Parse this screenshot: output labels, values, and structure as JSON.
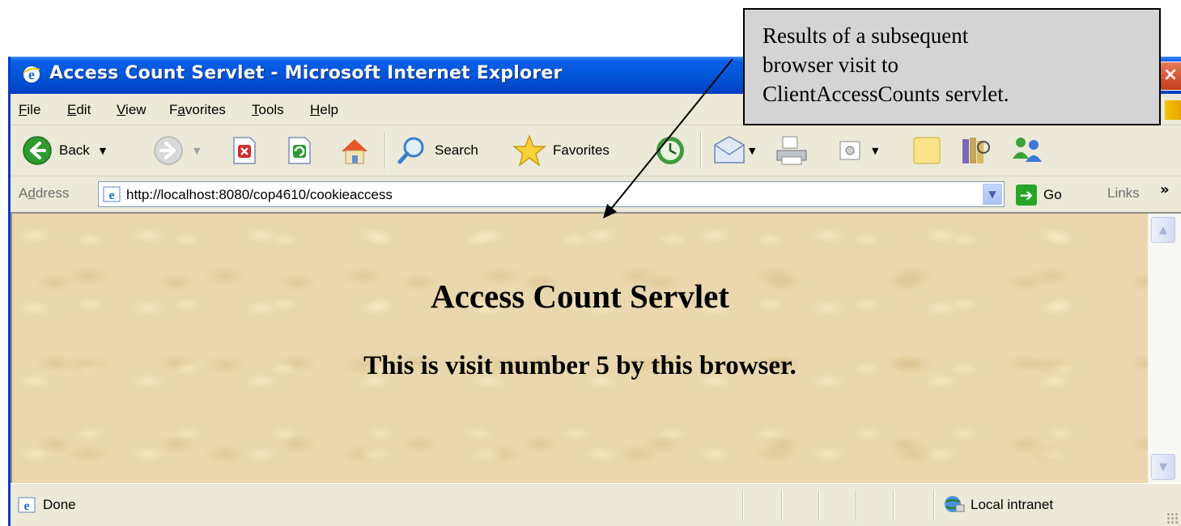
{
  "window": {
    "title": "Access Count Servlet - Microsoft Internet Explorer",
    "close_glyph": "×"
  },
  "menu": {
    "items": [
      {
        "accel": "F",
        "rest": "ile"
      },
      {
        "accel": "E",
        "rest": "dit"
      },
      {
        "accel": "V",
        "rest": "iew"
      },
      {
        "pre": "F",
        "accel": "a",
        "rest": "vorites"
      },
      {
        "accel": "T",
        "rest": "ools"
      },
      {
        "accel": "H",
        "rest": "elp"
      }
    ]
  },
  "toolbar": {
    "back_label": "Back",
    "search_label": "Search",
    "favorites_label": "Favorites",
    "dropdown_glyph": "▼"
  },
  "address": {
    "label_pre": "A",
    "label_accel": "d",
    "label_rest": "dress",
    "url": "http://localhost:8080/cop4610/cookieaccess",
    "go_label": "Go",
    "go_glyph": "➔",
    "links_label": "Links",
    "links_chevron": "»",
    "dropdown_glyph": "▼"
  },
  "page": {
    "heading": "Access Count Servlet",
    "subheading": "This is visit number 5 by this browser."
  },
  "scrollbar": {
    "up_glyph": "▲",
    "down_glyph": "▼"
  },
  "status": {
    "text": "Done",
    "zone": "Local intranet"
  },
  "callout": {
    "lines": [
      "Results of a subsequent",
      "browser visit to",
      "ClientAccessCounts servlet."
    ]
  },
  "icons": {
    "ie": "ie-icon",
    "back": "back-arrow-icon",
    "forward": "forward-arrow-icon",
    "stop": "stop-icon",
    "refresh": "refresh-icon",
    "home": "home-icon",
    "search": "search-magnifier-icon",
    "favorites": "favorites-star-icon",
    "history": "history-icon",
    "mail": "mail-icon",
    "print": "print-icon",
    "edit": "edit-icon",
    "discuss": "discuss-icon",
    "research": "research-icon",
    "messenger": "messenger-icon",
    "zone": "local-intranet-icon"
  },
  "colors": {
    "titlebar": "#0256d8",
    "page_background": "#ead7ad",
    "chrome": "#ece9d8",
    "callout_bg": "#d4d4d4"
  }
}
